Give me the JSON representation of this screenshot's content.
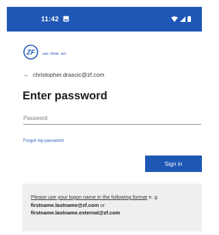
{
  "status_bar": {
    "time": "11:42",
    "background_color": "#1f57b5",
    "icons": [
      "image-icon",
      "wifi-icon",
      "signal-icon",
      "battery-icon"
    ]
  },
  "brand": {
    "logo_text": "ZF",
    "tagline": "see. think. act.",
    "color": "#1f57b5"
  },
  "account": {
    "back_icon": "back-arrow-icon",
    "email": "christopher.drascic@zf.com"
  },
  "title": "Enter password",
  "password": {
    "placeholder": "Password",
    "value": ""
  },
  "forgot_password": "Forgot my password",
  "sign_in_button": "Sign in",
  "info": {
    "part1": "Please use your logon name in the following format",
    "part2": " e. g. ",
    "example1": "firstname.lastname@zf.com",
    "part3": " or ",
    "example2": "firstname.lastname.external@zf.com"
  }
}
